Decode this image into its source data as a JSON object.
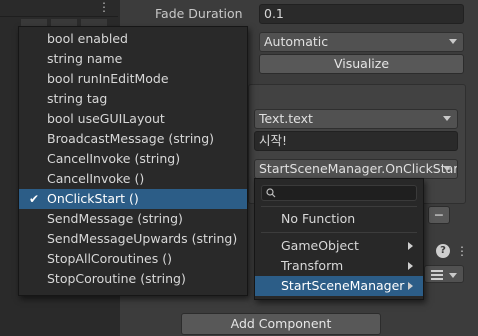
{
  "inspector": {
    "fade_duration_label": "Fade Duration",
    "fade_duration_value": "0.1",
    "navigation_mode": "Automatic",
    "visualize_label": "Visualize",
    "function_field": "Text.text",
    "text_value": "시작!",
    "onclick_target": "StartSceneManager.OnClickStar",
    "remove_label": "−",
    "add_component_label": "Add Component",
    "dots": "⋮"
  },
  "menu": {
    "items": [
      {
        "label": "bool enabled",
        "selected": false
      },
      {
        "label": "string name",
        "selected": false
      },
      {
        "label": "bool runInEditMode",
        "selected": false
      },
      {
        "label": "string tag",
        "selected": false
      },
      {
        "label": "bool useGUILayout",
        "selected": false
      },
      {
        "label": "BroadcastMessage (string)",
        "selected": false
      },
      {
        "label": "CancelInvoke (string)",
        "selected": false
      },
      {
        "label": "CancelInvoke ()",
        "selected": false
      },
      {
        "label": "OnClickStart ()",
        "selected": true
      },
      {
        "label": "SendMessage (string)",
        "selected": false
      },
      {
        "label": "SendMessageUpwards (string)",
        "selected": false
      },
      {
        "label": "StopAllCoroutines ()",
        "selected": false
      },
      {
        "label": "StopCoroutine (string)",
        "selected": false
      }
    ]
  },
  "submenu": {
    "search_placeholder": "",
    "no_function": "No Function",
    "items": [
      {
        "label": "GameObject",
        "selected": false
      },
      {
        "label": "Transform",
        "selected": false
      },
      {
        "label": "StartSceneManager",
        "selected": true
      }
    ]
  },
  "colors": {
    "selection": "#2c5d87",
    "menu_bg": "#292929",
    "inspector_bg": "#3c3c3c"
  }
}
